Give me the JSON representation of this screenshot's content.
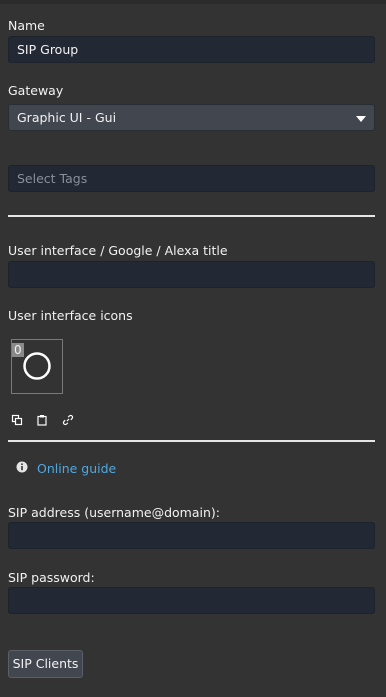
{
  "form": {
    "name": {
      "label": "Name",
      "value": "SIP Group"
    },
    "gateway": {
      "label": "Gateway",
      "value": "Graphic UI - Gui"
    },
    "tags": {
      "placeholder": "Select Tags"
    },
    "ui_title": {
      "label": "User interface / Google / Alexa title",
      "value": ""
    },
    "ui_icons": {
      "label": "User interface icons",
      "count": "0"
    },
    "icon_tools": [
      "copy-icon",
      "paste-icon",
      "link-icon"
    ],
    "guide": {
      "icon": "info-icon",
      "label": "Online guide"
    },
    "sip_address": {
      "label": "SIP address (username@domain):",
      "value": ""
    },
    "sip_password": {
      "label": "SIP password:",
      "value": ""
    },
    "sip_clients_button": "SIP Clients"
  },
  "colors": {
    "background": "#333333",
    "input_bg": "#222834",
    "select_bg": "#41464f",
    "link": "#4fa8e0",
    "divider": "#e6e6e6"
  }
}
